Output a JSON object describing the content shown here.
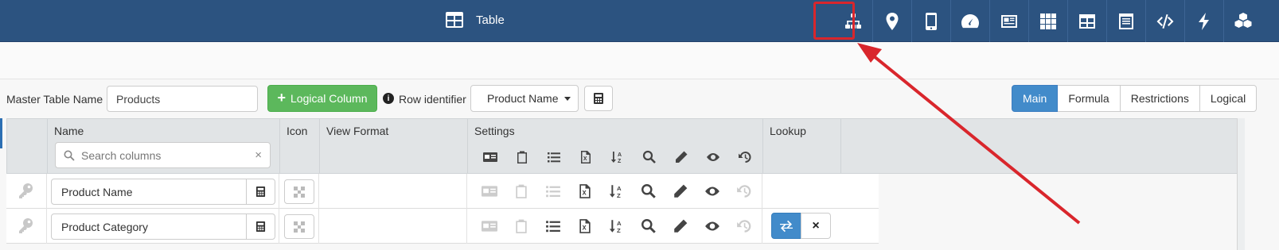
{
  "header": {
    "title": "Table",
    "toolbar_icons": [
      "hierarchy-icon",
      "map-marker-icon",
      "mobile-icon",
      "dashboard-icon",
      "newspaper-icon",
      "grid-icon",
      "table-icon",
      "list-alt-icon",
      "code-icon",
      "bolt-icon",
      "cubes-icon"
    ]
  },
  "form": {
    "master_table_label": "Master Table Name",
    "master_table_value": "Products",
    "logical_column_button": "Logical Column",
    "row_identifier_label": "Row identifier",
    "row_identifier_value": "Product Name"
  },
  "tabs": [
    {
      "label": "Main",
      "active": true
    },
    {
      "label": "Formula",
      "active": false
    },
    {
      "label": "Restrictions",
      "active": false
    },
    {
      "label": "Logical",
      "active": false
    }
  ],
  "grid": {
    "columns": {
      "name": "Name",
      "icon": "Icon",
      "view_format": "View Format",
      "settings": "Settings",
      "lookup": "Lookup"
    },
    "search_placeholder": "Search columns",
    "search_clear": "×",
    "rows": [
      {
        "name": "Product Name",
        "has_lookup": false
      },
      {
        "name": "Product Category",
        "has_lookup": true
      }
    ],
    "lookup_clear": "×"
  },
  "colors": {
    "topbar": "#2c5380",
    "accent_blue": "#428bca",
    "green": "#5cb85c",
    "highlight_red": "#d9262c"
  }
}
